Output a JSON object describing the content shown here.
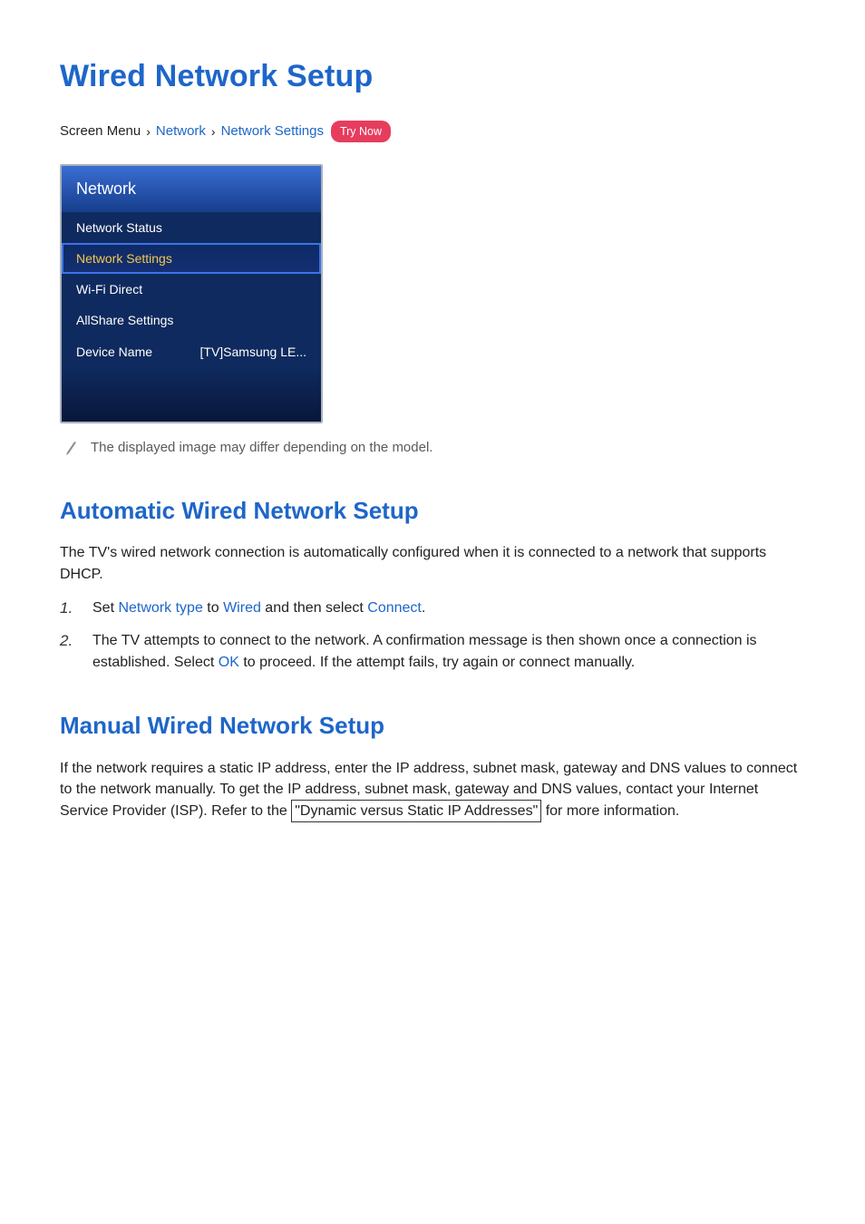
{
  "page": {
    "title": "Wired Network Setup"
  },
  "breadcrumb": {
    "prefix": "Screen Menu",
    "item1": "Network",
    "item2": "Network Settings",
    "try_now": "Try Now"
  },
  "menu": {
    "header": "Network",
    "items": [
      {
        "label": "Network Status",
        "value": ""
      },
      {
        "label": "Network Settings",
        "value": ""
      },
      {
        "label": "Wi-Fi Direct",
        "value": ""
      },
      {
        "label": "AllShare Settings",
        "value": ""
      },
      {
        "label": "Device Name",
        "value": "[TV]Samsung LE..."
      }
    ]
  },
  "note": "The displayed image may differ depending on the model.",
  "auto": {
    "title": "Automatic Wired Network Setup",
    "intro": "The TV's wired network connection is automatically configured when it is connected to a network that supports DHCP.",
    "step1": {
      "num": "1.",
      "pre": "Set ",
      "kw1": "Network type",
      "mid1": " to ",
      "kw2": "Wired",
      "mid2": " and then select ",
      "kw3": "Connect",
      "post": "."
    },
    "step2": {
      "num": "2.",
      "pre": "The TV attempts to connect to the network. A confirmation message is then shown once a connection is established. Select ",
      "kw1": "OK",
      "post": " to proceed. If the attempt fails, try again or connect manually."
    }
  },
  "manual": {
    "title": "Manual Wired Network Setup",
    "para_pre": "If the network requires a static IP address, enter the IP address, subnet mask, gateway and DNS values to connect to the network manually. To get the IP address, subnet mask, gateway and DNS values, contact your Internet Service Provider (ISP). Refer to the ",
    "link": "\"Dynamic versus Static IP Addresses\"",
    "para_post": " for more information."
  }
}
